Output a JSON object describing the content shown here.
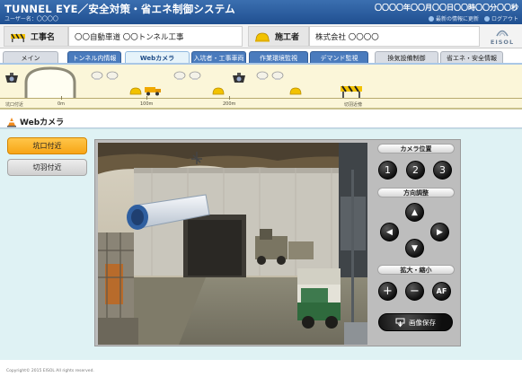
{
  "header": {
    "title": "TUNNEL EYE／安全対策・省エネ制御システム",
    "user": "ユーザー名：〇〇〇〇",
    "datetime": "〇〇〇〇年〇〇月〇〇日〇〇時〇〇分〇〇秒",
    "links": [
      {
        "label": "最新の情報に更新",
        "icon": "refresh-icon"
      },
      {
        "label": "ログアウト",
        "icon": "logout-icon"
      }
    ],
    "brand_color": "#2a5c9e"
  },
  "project": {
    "work_label": "工事名",
    "work_value": "〇〇自動車道 〇〇トンネル工事",
    "contractor_label": "施工者",
    "contractor_value": "株式会社 〇〇〇〇",
    "logo_text": "EISOL"
  },
  "tabs": [
    {
      "label": "メイン",
      "style": "light"
    },
    {
      "label": "トンネル内情報",
      "style": "blue"
    },
    {
      "label": "Webカメラ",
      "style": "active"
    },
    {
      "label": "入坑者・工事車両",
      "style": "blue"
    },
    {
      "label": "作業環境監視",
      "style": "blue"
    },
    {
      "label": "デマンド監視",
      "style": "blue"
    },
    {
      "label": "換気設備制御",
      "style": "light"
    },
    {
      "label": "省エネ・安全情報",
      "style": "light"
    }
  ],
  "tunnel_map": {
    "labels": [
      "坑口付近",
      "0m",
      "100m",
      "200m",
      "切羽近傍"
    ],
    "markers": [
      "camera-icon",
      "light-icon",
      "helmet-icon",
      "vehicle-icon",
      "barrier-icon"
    ]
  },
  "section": {
    "title": "Webカメラ",
    "icon": "cone-icon"
  },
  "camera_select": [
    {
      "label": "坑口付近",
      "selected": true
    },
    {
      "label": "切羽付近",
      "selected": false
    }
  ],
  "controls": {
    "position_title": "カメラ位置",
    "position_buttons": [
      "1",
      "2",
      "3"
    ],
    "direction_title": "方向調整",
    "direction_buttons": [
      "▲",
      "◀",
      "▶",
      "▼"
    ],
    "zoom_title": "拡大・縮小",
    "zoom_buttons": [
      "+",
      "−",
      "AF"
    ],
    "save_label": "画像保存"
  },
  "copyright": "Copyright© 2015 EISOL All rights reserved."
}
